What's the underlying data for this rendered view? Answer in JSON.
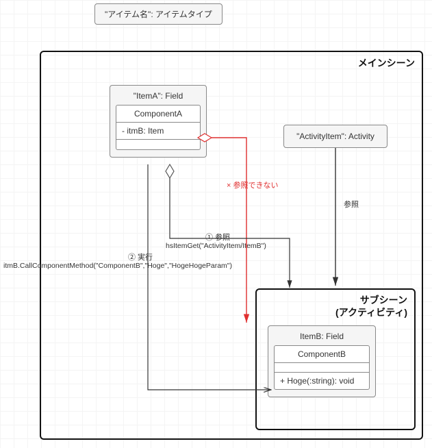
{
  "legend": {
    "text": "\"アイテム名\": アイテムタイプ"
  },
  "main_scene": {
    "label": "メインシーン"
  },
  "sub_scene": {
    "line1": "サブシーン",
    "line2": "(アクティビティ)"
  },
  "item_a": {
    "title": "\"ItemA\": Field",
    "component": {
      "name": "ComponentA",
      "attr": "- itmB: Item"
    }
  },
  "activity_item": {
    "title": "\"ActivityItem\": Activity"
  },
  "item_b": {
    "title": "ItemB: Field",
    "component": {
      "name": "ComponentB",
      "method": "+ Hoge(:string): void"
    }
  },
  "edges": {
    "cannot_ref": "× 参照できない",
    "ref_activity": "参照",
    "step1_label": "① 参照",
    "step1_code": "hsItemGet(\"ActivityItem/ItemB\")",
    "step2_label": "② 実行",
    "step2_code": "itmB.CallComponentMethod(\"ComponentB\",\"Hoge\",\"HogeHogeParam\")"
  }
}
